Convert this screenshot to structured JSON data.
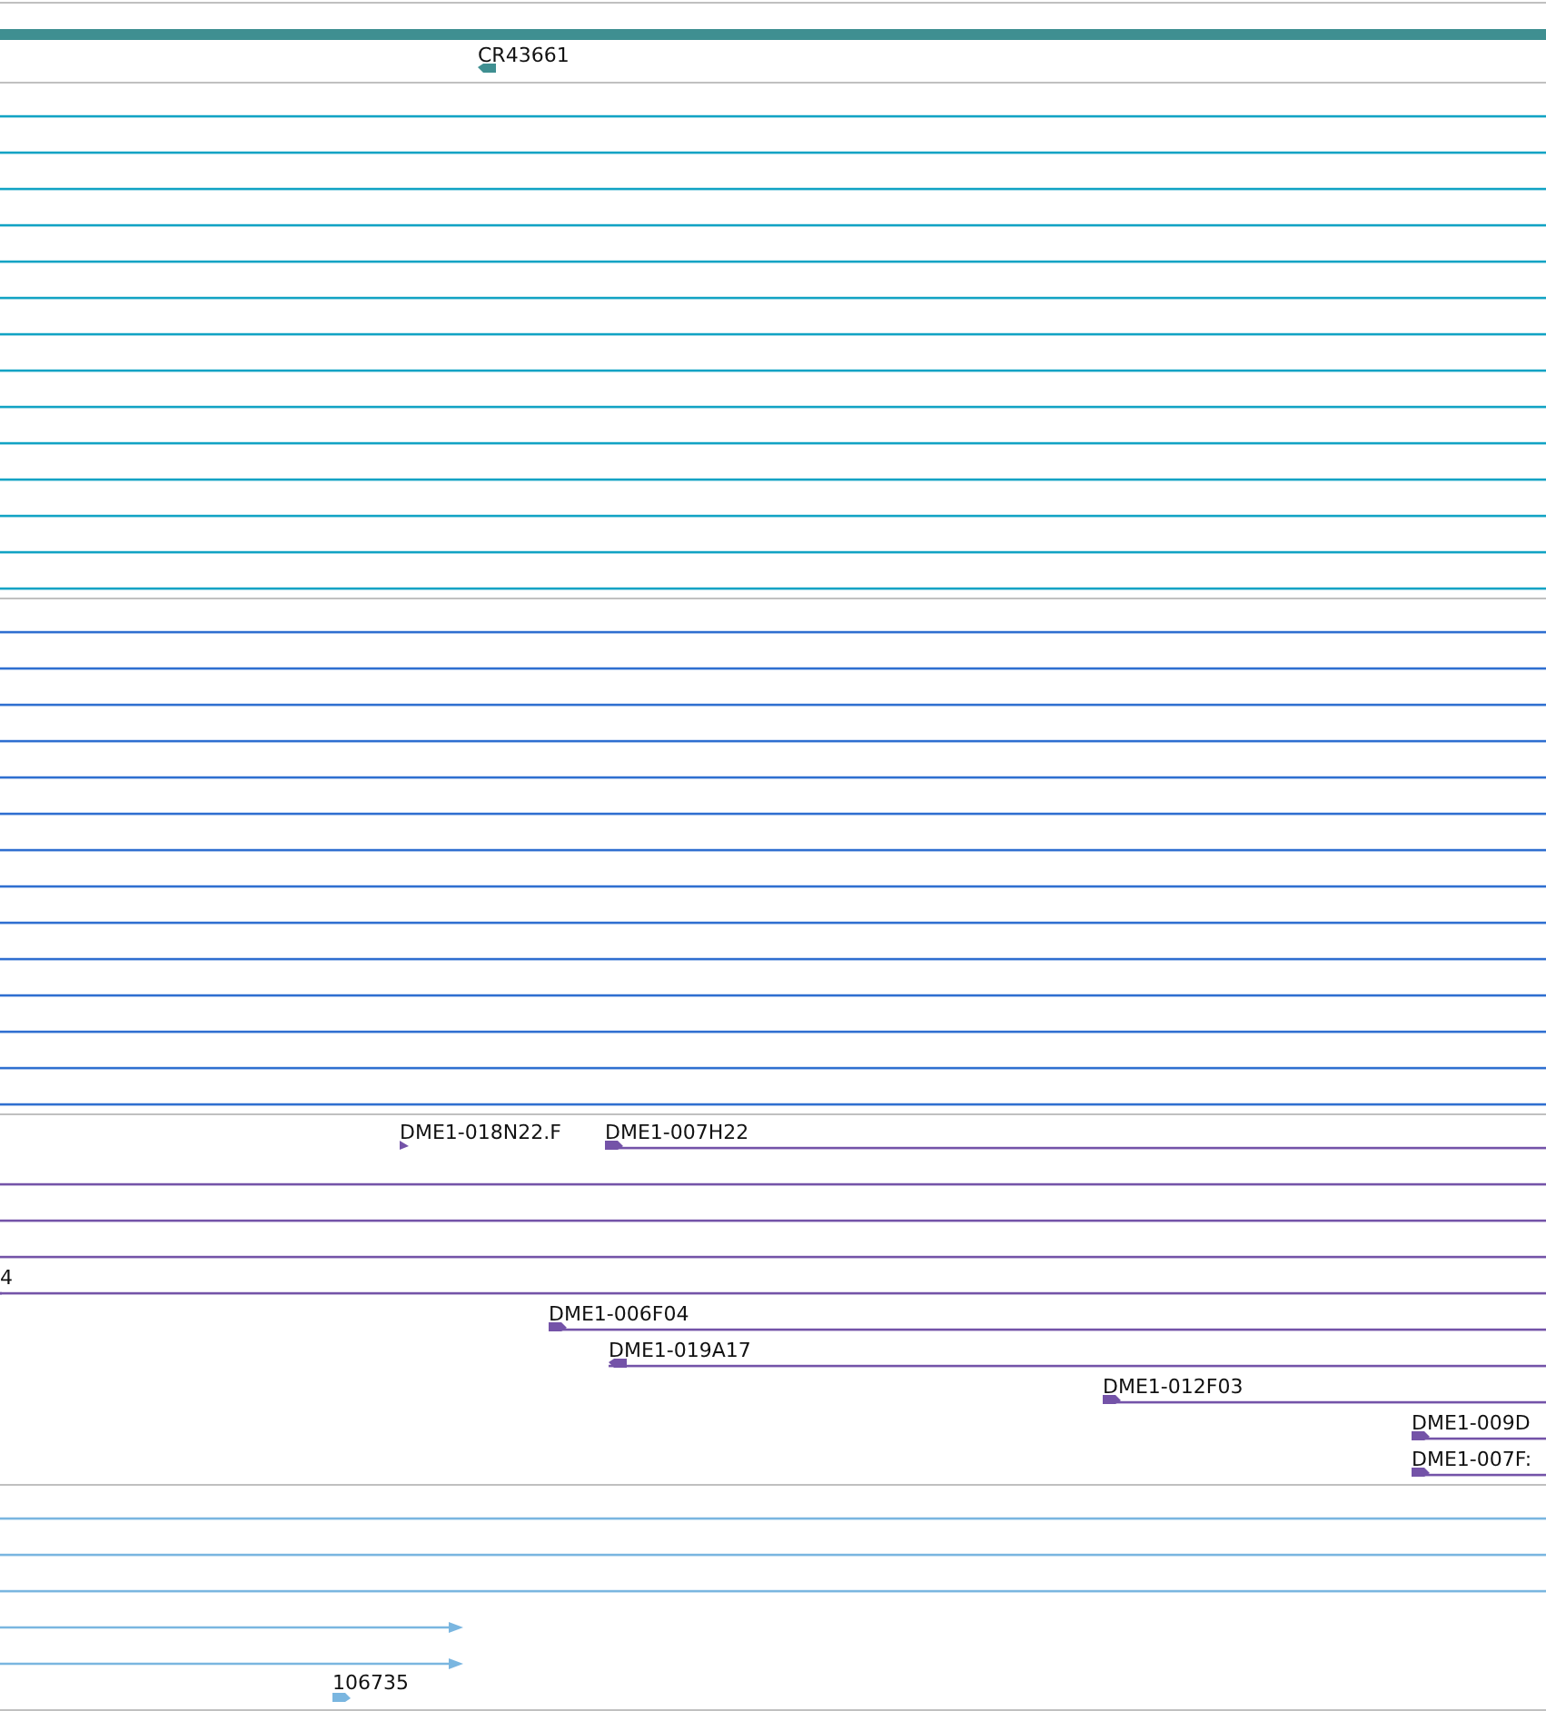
{
  "tracks": [
    {
      "kind": "gene",
      "color": "#3f8f91",
      "features": [
        {
          "label": "CR43661",
          "reverse": true
        }
      ]
    },
    {
      "kind": "lines",
      "color": "#12a3c4"
    },
    {
      "kind": "lines",
      "color": "#2f6fd0"
    },
    {
      "kind": "features",
      "color": "#7453a8",
      "features": [
        {
          "label": "DME1-018N22.F",
          "reverse": false
        },
        {
          "label": "DME1-007H22",
          "reverse": false
        },
        {
          "label": "4",
          "reverse": false
        },
        {
          "label": "DME1-006F04",
          "reverse": false
        },
        {
          "label": "DME1-019A17",
          "reverse": true
        },
        {
          "label": "DME1-012F03",
          "reverse": false
        },
        {
          "label": "DME1-009D",
          "reverse": false
        },
        {
          "label": "DME1-007F:",
          "reverse": false
        }
      ]
    },
    {
      "kind": "features",
      "color": "#7ab6e0",
      "features": [
        {
          "label": "106735",
          "reverse": false
        }
      ]
    }
  ]
}
